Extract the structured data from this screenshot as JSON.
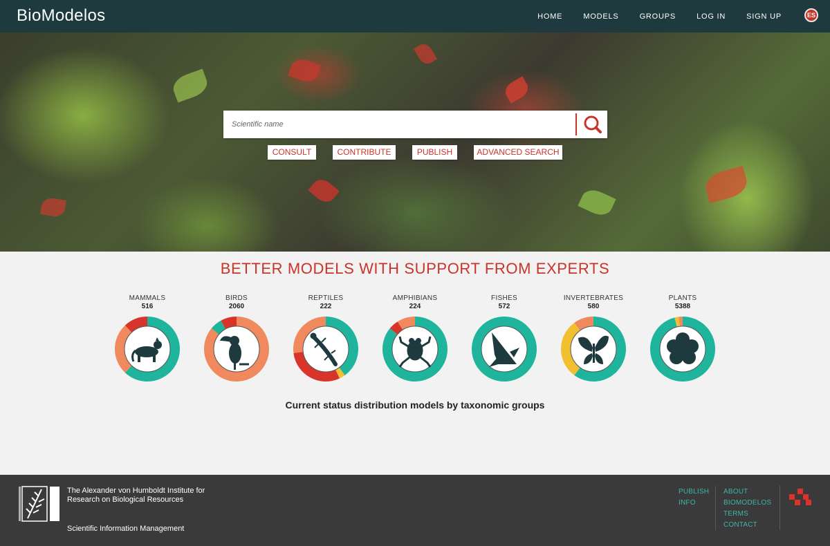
{
  "header": {
    "brand": "BioModelos",
    "nav": [
      "HOME",
      "MODELS",
      "GROUPS",
      "LOG IN",
      "SIGN UP"
    ],
    "lang": "ES"
  },
  "search": {
    "placeholder": "Scientific name",
    "buttons": [
      "CONSULT",
      "CONTRIBUTE",
      "PUBLISH",
      "ADVANCED SEARCH"
    ]
  },
  "tagline": "BETTER MODELS WITH SUPPORT FROM EXPERTS",
  "groups": [
    {
      "name": "MAMMALS",
      "count": "516",
      "icon": "mammal-icon",
      "segments": [
        {
          "color": "#1fb49c",
          "frac": 0.62
        },
        {
          "color": "#f0895d",
          "frac": 0.26
        },
        {
          "color": "#d9342a",
          "frac": 0.12
        }
      ]
    },
    {
      "name": "BIRDS",
      "count": "2060",
      "icon": "toucan-icon",
      "segments": [
        {
          "color": "#f0895d",
          "frac": 0.86
        },
        {
          "color": "#1fb49c",
          "frac": 0.06
        },
        {
          "color": "#d9342a",
          "frac": 0.08
        }
      ]
    },
    {
      "name": "REPTILES",
      "count": "222",
      "icon": "lizard-icon",
      "segments": [
        {
          "color": "#1fb49c",
          "frac": 0.4
        },
        {
          "color": "#f0c030",
          "frac": 0.03
        },
        {
          "color": "#d9342a",
          "frac": 0.3
        },
        {
          "color": "#f0895d",
          "frac": 0.27
        }
      ]
    },
    {
      "name": "AMPHIBIANS",
      "count": "224",
      "icon": "frog-icon",
      "segments": [
        {
          "color": "#1fb49c",
          "frac": 0.86
        },
        {
          "color": "#d9342a",
          "frac": 0.05
        },
        {
          "color": "#f0895d",
          "frac": 0.09
        }
      ]
    },
    {
      "name": "FISHES",
      "count": "572",
      "icon": "fish-icon",
      "segments": [
        {
          "color": "#1fb49c",
          "frac": 1.0
        }
      ]
    },
    {
      "name": "INVERTEBRATES",
      "count": "580",
      "icon": "butterfly-icon",
      "segments": [
        {
          "color": "#1fb49c",
          "frac": 0.6
        },
        {
          "color": "#f0c030",
          "frac": 0.3
        },
        {
          "color": "#f0895d",
          "frac": 0.1
        }
      ]
    },
    {
      "name": "PLANTS",
      "count": "5388",
      "icon": "flower-icon",
      "segments": [
        {
          "color": "#1fb49c",
          "frac": 0.96
        },
        {
          "color": "#f0c030",
          "frac": 0.02
        },
        {
          "color": "#f0895d",
          "frac": 0.02
        }
      ]
    }
  ],
  "caption": "Current status distribution models by taxonomic groups",
  "footer": {
    "institute": "The Alexander von Humboldt Institute for Research on Biological Resources",
    "sim": "Scientific Information Management",
    "links_left": [
      "PUBLISH",
      "INFO"
    ],
    "links_right": [
      "ABOUT",
      "BIOMODELOS",
      "TERMS",
      "CONTACT"
    ]
  },
  "colors": {
    "accent": "#c8342a",
    "teal": "#1fb49c",
    "header_bg": "#1f3a3f",
    "footer_bg": "#3a3a3a"
  }
}
